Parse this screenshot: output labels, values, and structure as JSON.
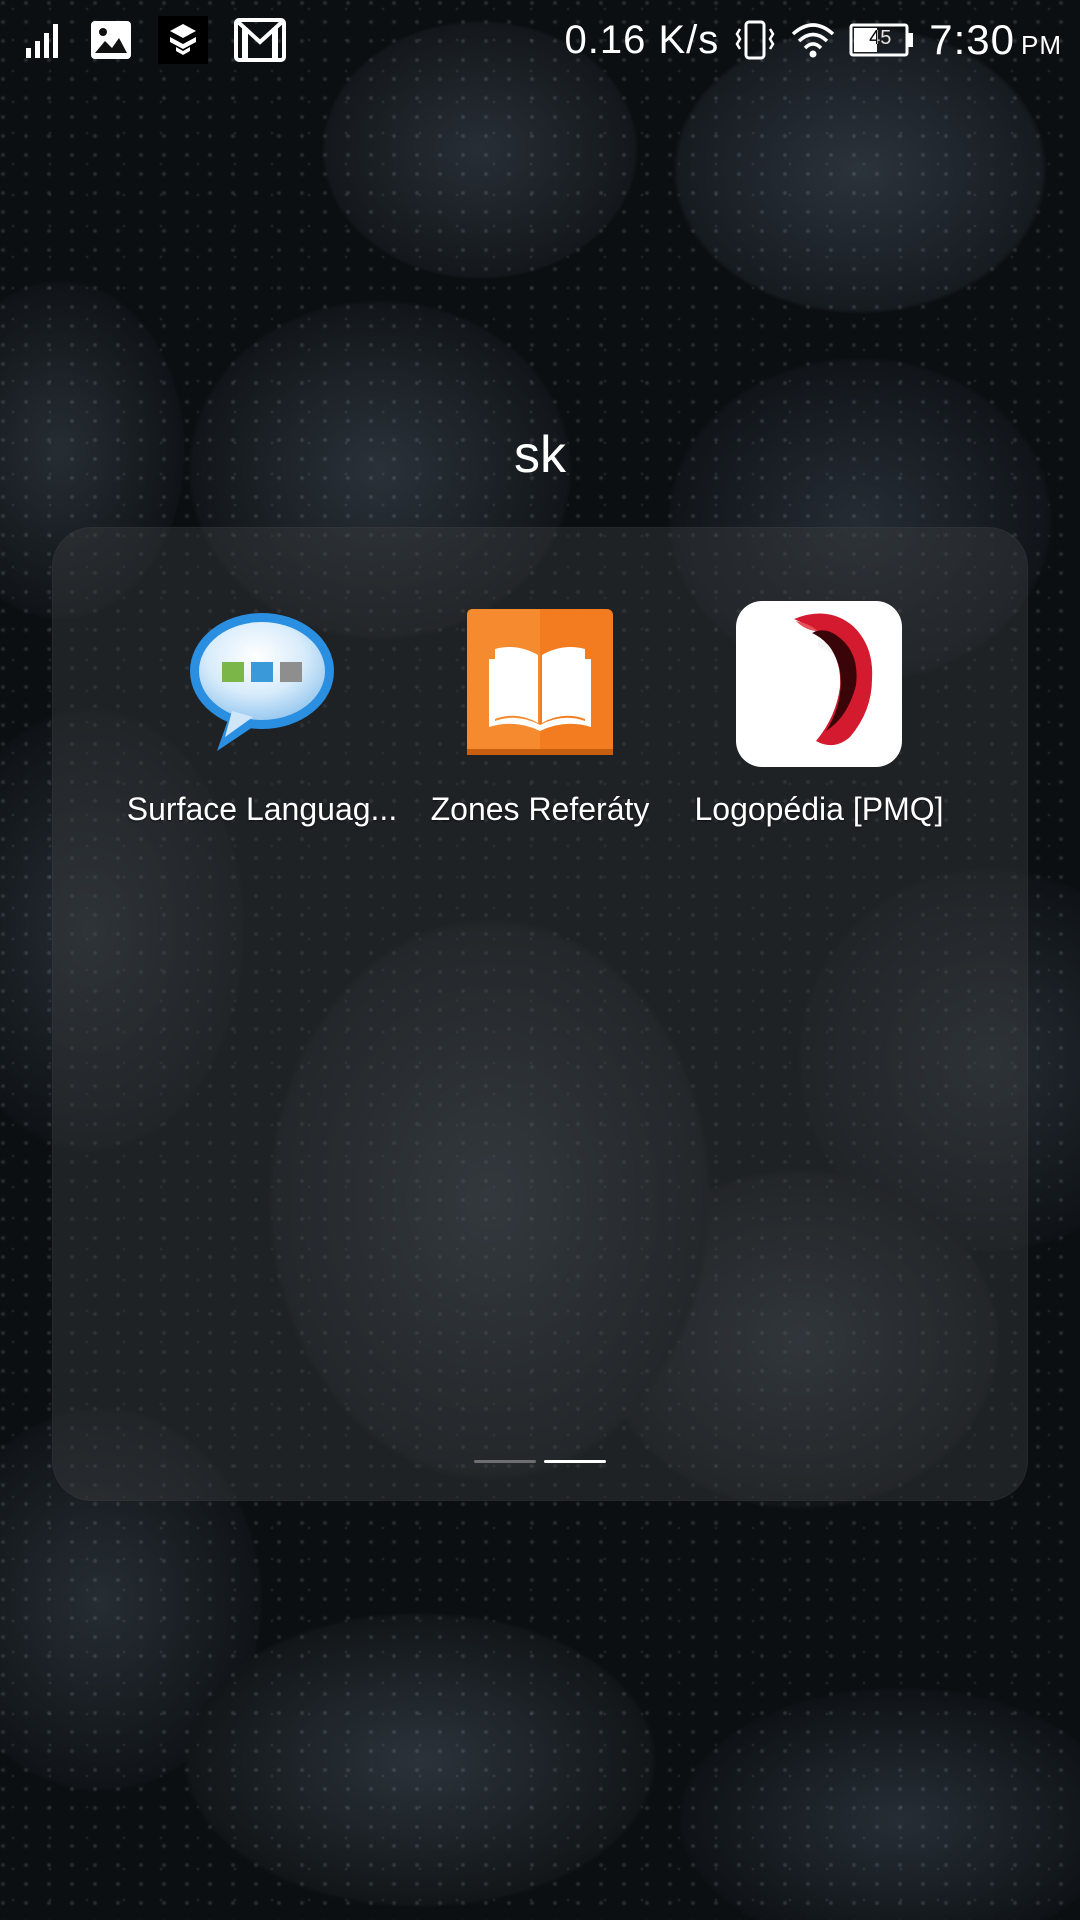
{
  "status_bar": {
    "network_speed": "0.16 K/s",
    "battery_level": "45",
    "time": "7:30",
    "ampm": "PM",
    "left_icons": [
      "signal-icon",
      "gallery-notification-icon",
      "app-notification-icon",
      "gmail-notification-icon"
    ],
    "right_icons": [
      "vibrate-icon",
      "wifi-icon",
      "battery-icon"
    ]
  },
  "folder": {
    "title": "sk",
    "apps": [
      {
        "label": "Surface Languag...",
        "icon": "chat-bubble-icon"
      },
      {
        "label": "Zones Referáty",
        "icon": "open-book-icon"
      },
      {
        "label": "Logopédia [PMQ]",
        "icon": "open-mouth-icon"
      }
    ],
    "pages": {
      "total": 2,
      "current": 2
    }
  },
  "colors": {
    "folder_background": "rgba(60,62,64,0.42)",
    "zones_orange": "#F47C20",
    "chat_blue": "#2A8FE0",
    "lips_red": "#D31A2E"
  }
}
